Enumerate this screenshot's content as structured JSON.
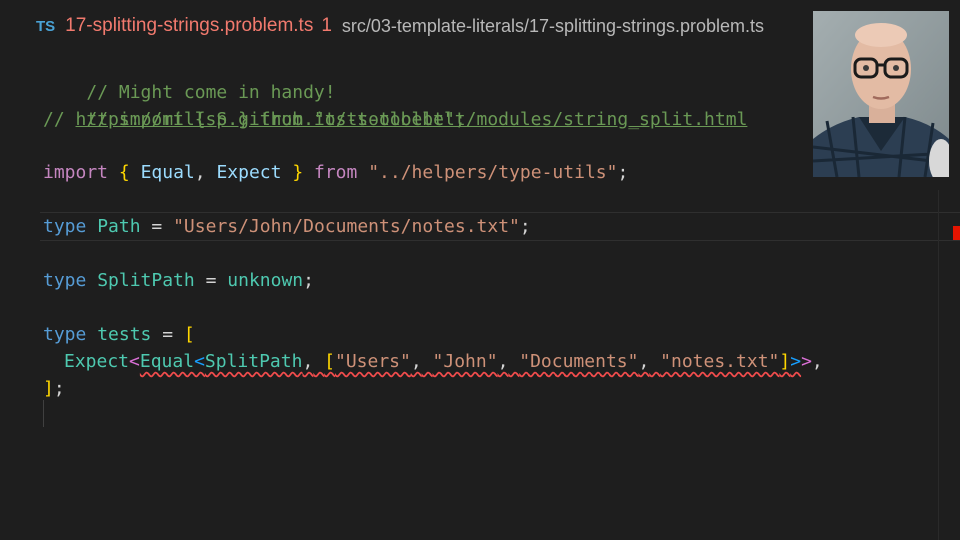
{
  "tab": {
    "icon": "TS",
    "filename": "17-splitting-strings.problem.ts",
    "problem_count": "1",
    "path": "src/03-template-literals/17-splitting-strings.problem.ts"
  },
  "code": {
    "line1": "// Might come in handy!",
    "line2": "// import { S } from \"ts-toolbelt\";",
    "line3_prefix": "// ",
    "line3_link": "https://millsp.github.io/ts-toolbelt/modules/string_split.html",
    "import_kw": "import",
    "import_names": [
      "Equal",
      "Expect"
    ],
    "from_kw": "from",
    "import_path": "\"../helpers/type-utils\"",
    "path_kw": "type",
    "path_name": "Path",
    "path_value": "\"Users/John/Documents/notes.txt\"",
    "split_kw": "type",
    "split_name": "SplitPath",
    "split_value": "unknown",
    "tests_kw": "type",
    "tests_name": "tests",
    "expect_type": "Expect",
    "equal_type": "Equal",
    "expected_parts": [
      "\"Users\"",
      "\"John\"",
      "\"Documents\"",
      "\"notes.txt\""
    ]
  },
  "colors": {
    "error": "#e51400",
    "tab_error_text": "#f27a6e",
    "background": "#1e1e1e"
  },
  "icons": {
    "file_type": "typescript-icon"
  }
}
